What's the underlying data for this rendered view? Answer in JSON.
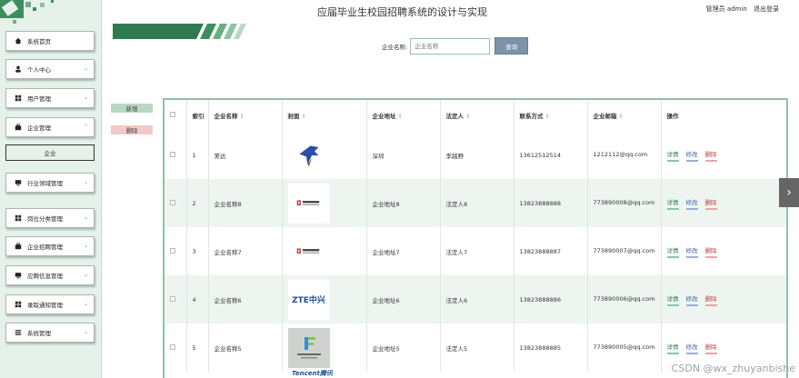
{
  "header": {
    "title": "应届毕业生校园招聘系统的设计与实现",
    "user": "管理员 admin",
    "logout": "退出登录"
  },
  "breadcrumb": {
    "home": "系统首页",
    "sep": ">",
    "current": "企业"
  },
  "search": {
    "label": "企业名称:",
    "placeholder": "企业名称",
    "button": "查询"
  },
  "actions": {
    "add": "新增",
    "delete": "删除"
  },
  "sidebar": {
    "items": [
      {
        "label": "系统首页",
        "icon": "home-icon",
        "chevron": ""
      },
      {
        "label": "个人中心",
        "icon": "person-icon",
        "chevron": "⌄"
      },
      {
        "label": "用户管理",
        "icon": "grid-icon",
        "chevron": "⌄"
      },
      {
        "label": "企业管理",
        "icon": "briefcase-icon",
        "chevron": "⌃"
      },
      {
        "label": "行业领域管理",
        "icon": "monitor-icon",
        "chevron": "⌄"
      },
      {
        "label": "岗位分类管理",
        "icon": "grid-icon",
        "chevron": "⌄"
      },
      {
        "label": "企业招聘管理",
        "icon": "briefcase-icon",
        "chevron": "⌄"
      },
      {
        "label": "应聘信息管理",
        "icon": "monitor-icon",
        "chevron": "⌄"
      },
      {
        "label": "录取通知管理",
        "icon": "grid-icon",
        "chevron": "⌄"
      },
      {
        "label": "系统管理",
        "icon": "list-icon",
        "chevron": "⌄"
      }
    ],
    "submenu": "企业"
  },
  "table": {
    "columns": {
      "index": "索引",
      "name": "企业名称",
      "cover": "封面",
      "address": "企业地址",
      "legal": "法定人",
      "phone": "联系方式",
      "email": "企业邮箱",
      "ops": "操作"
    },
    "sort_mark": "⇕",
    "rows": [
      {
        "index": "1",
        "name": "美达",
        "cover": "bird-logo",
        "address": "深圳",
        "legal": "李越野",
        "phone": "13612512514",
        "email": "1212112@qq.com"
      },
      {
        "index": "2",
        "name": "企业名称8",
        "cover": "group-logo",
        "address": "企业地址8",
        "legal": "法定人8",
        "phone": "13823888888",
        "email": "773890008@qq.com"
      },
      {
        "index": "3",
        "name": "企业名称7",
        "cover": "group-logo",
        "address": "企业地址7",
        "legal": "法定人7",
        "phone": "13823888887",
        "email": "773890007@qq.com"
      },
      {
        "index": "4",
        "name": "企业名称6",
        "cover": "zte-logo",
        "address": "企业地址6",
        "legal": "法定人6",
        "phone": "13823888886",
        "email": "773890006@qq.com"
      },
      {
        "index": "5",
        "name": "企业名称5",
        "cover": "fs-logo",
        "address": "企业地址5",
        "legal": "法定人5",
        "phone": "13823888885",
        "email": "773890005@qq.com"
      }
    ],
    "op_labels": {
      "detail": "详情",
      "edit": "修改",
      "delete": "删除"
    },
    "logo_text": {
      "zte": "ZTE中兴",
      "tencent": "Tencent腾讯"
    }
  },
  "watermark": "CSDN @wx_zhuyanbishe",
  "colors": {
    "accent": "#2f7a4f",
    "sidebar_bg": "#e6f1ea",
    "button": "#7d93aa"
  }
}
